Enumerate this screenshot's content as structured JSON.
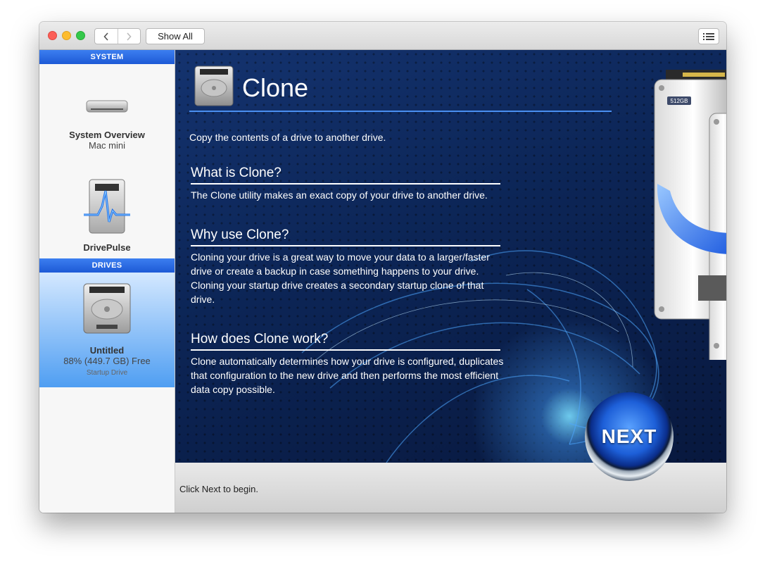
{
  "toolbar": {
    "show_all_label": "Show All"
  },
  "sidebar": {
    "system_header": "SYSTEM",
    "system_overview": {
      "title": "System Overview",
      "subtitle": "Mac mini"
    },
    "drivepulse": {
      "title": "DrivePulse"
    },
    "drives_header": "DRIVES",
    "drive": {
      "name": "Untitled",
      "free": "88% (449.7 GB) Free",
      "type": "Startup Drive"
    }
  },
  "main": {
    "title": "Clone",
    "description": "Copy the contents of a drive to another drive.",
    "drive_badge": "512GB",
    "sections": [
      {
        "heading": "What is Clone?",
        "body": "The Clone utility makes an exact copy of your drive to another drive."
      },
      {
        "heading": "Why use Clone?",
        "body": "Cloning your drive is a great way to move your data to a larger/faster drive or create a backup in case something happens to your drive. Cloning your startup drive creates a secondary startup clone of that drive."
      },
      {
        "heading": "How does Clone work?",
        "body": "Clone automatically determines how your drive is configured, duplicates that configuration to the new drive and then performs the most efficient data copy possible."
      }
    ],
    "footer_hint": "Click Next to begin.",
    "next_label": "NEXT"
  },
  "colors": {
    "accent": "#1d59d6",
    "panel_bg": "#0c2556",
    "selection": "#4f9ef2"
  }
}
